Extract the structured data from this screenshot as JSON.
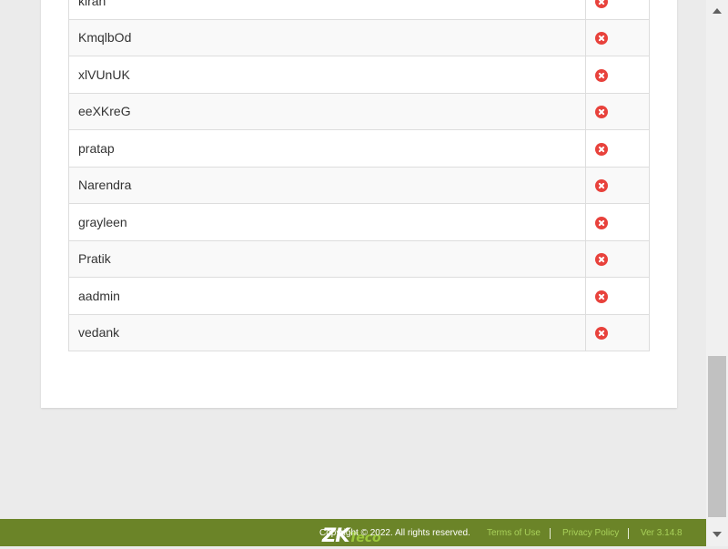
{
  "users": [
    {
      "name": "kiran"
    },
    {
      "name": "KmqlbOd"
    },
    {
      "name": "xlVUnUK"
    },
    {
      "name": "eeXKreG"
    },
    {
      "name": "pratap"
    },
    {
      "name": "Narendra"
    },
    {
      "name": "grayleen"
    },
    {
      "name": "Pratik"
    },
    {
      "name": "aadmin"
    },
    {
      "name": "vedank"
    }
  ],
  "footer": {
    "logo_primary": "ZK",
    "logo_secondary": "Teco",
    "copyright": "Copyright © 2022. All rights reserved.",
    "terms_label": "Terms of Use",
    "privacy_label": "Privacy Policy",
    "version": "Ver 3.14.8"
  },
  "icons": {
    "delete": "remove-circle-icon"
  },
  "colors": {
    "footer_bg": "#6b8428",
    "footer_link": "#a9d15a",
    "delete_icon": "#e8423c"
  }
}
